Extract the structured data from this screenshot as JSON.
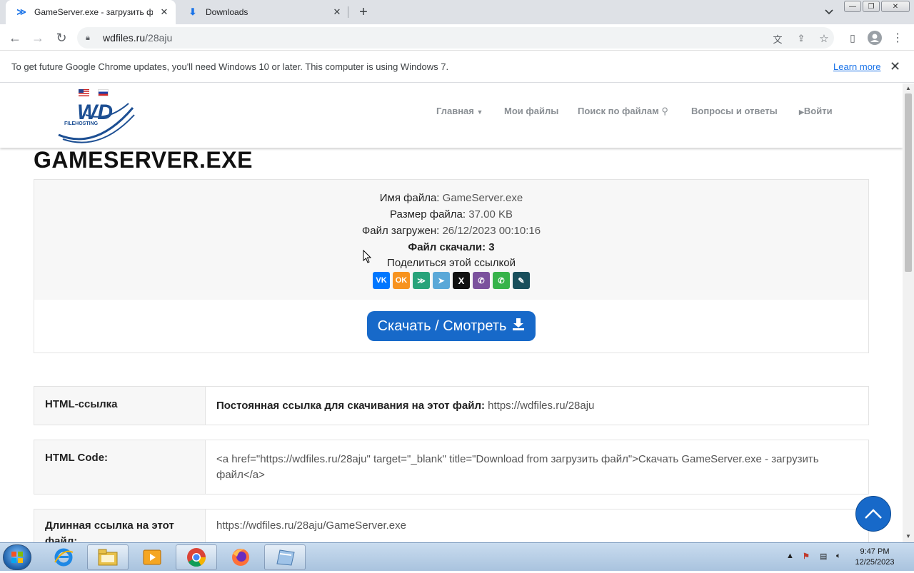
{
  "browser": {
    "tabs": [
      {
        "title": "GameServer.exe - загрузить фай",
        "active": true
      },
      {
        "title": "Downloads",
        "active": false
      }
    ],
    "url_host": "wdfiles.ru",
    "url_path": "/28aju",
    "infobar_message": "To get future Google Chrome updates, you'll need Windows 10 or later. This computer is using Windows 7.",
    "infobar_link": "Learn more"
  },
  "site": {
    "logo_text": "WD",
    "logo_subtext": "FILEHOSTING",
    "nav": [
      "Главная",
      "Мои файлы",
      "Поиск по файлам",
      "Вопросы и ответы",
      "Войти"
    ]
  },
  "file": {
    "heading": "GAMESERVER.EXE",
    "name_label": "Имя файла:",
    "name_value": "GameServer.exe",
    "size_label": "Размер файла:",
    "size_value": "37.00 KB",
    "uploaded_label": "Файл загружен:",
    "uploaded_value": "26/12/2023 00:10:16",
    "downloads_text": "Файл скачали: 3",
    "share_label": "Поделиться этой ссылкой",
    "share_buttons": [
      {
        "icon": "vk-icon",
        "glyph": "VK",
        "color": "#0077ff"
      },
      {
        "icon": "odnoklassniki-icon",
        "glyph": "OK",
        "color": "#f7931e"
      },
      {
        "icon": "sferum-icon",
        "glyph": "≫",
        "color": "#27a37a"
      },
      {
        "icon": "telegram-icon",
        "glyph": "➤",
        "color": "#5aa8d8"
      },
      {
        "icon": "x-icon",
        "glyph": "X",
        "color": "#111111"
      },
      {
        "icon": "viber-icon",
        "glyph": "✆",
        "color": "#7b519d"
      },
      {
        "icon": "whatsapp-icon",
        "glyph": "✆",
        "color": "#37b34a"
      },
      {
        "icon": "livejournal-icon",
        "glyph": "✎",
        "color": "#194f5c"
      }
    ],
    "download_button": "Скачать / Смотреть"
  },
  "links": [
    {
      "key": "HTML-ссылка",
      "bold": "Постоянная ссылка для скачивания на этот файл:",
      "value": "https://wdfiles.ru/28aju"
    },
    {
      "key": "HTML Code:",
      "bold": "",
      "value": "<a href=\"https://wdfiles.ru/28aju\" target=\"_blank\" title=\"Download from загрузить файл\">Скачать GameServer.exe - загрузить файл</a>"
    },
    {
      "key": "Длинная ссылка на этот файл:",
      "bold": "",
      "value": "https://wdfiles.ru/28aju/GameServer.exe"
    }
  ],
  "taskbar": {
    "time": "9:47 PM",
    "date": "12/25/2023"
  }
}
